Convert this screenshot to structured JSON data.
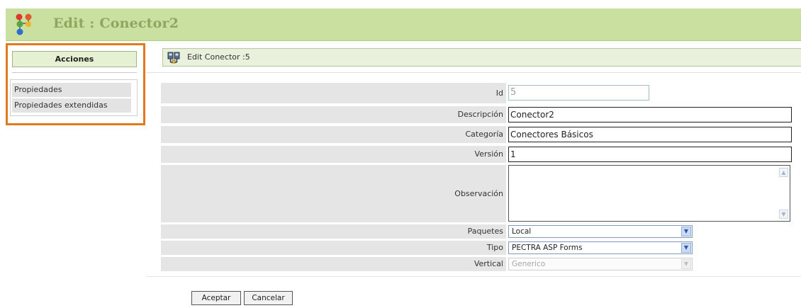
{
  "header": {
    "title": "Edit : Conector2"
  },
  "sidebar": {
    "heading": "Acciones",
    "items": [
      {
        "label": "Propiedades"
      },
      {
        "label": "Propiedades extendidas"
      }
    ]
  },
  "panel": {
    "title": "Edit Conector :5"
  },
  "form": {
    "id": {
      "label": "Id",
      "value": "5"
    },
    "descripcion": {
      "label": "Descripción",
      "value": "Conector2"
    },
    "categoria": {
      "label": "Categoría",
      "value": "Conectores Básicos"
    },
    "version": {
      "label": "Versión",
      "value": "1"
    },
    "observacion": {
      "label": "Observación",
      "value": ""
    },
    "paquetes": {
      "label": "Paquetes",
      "value": "Local"
    },
    "tipo": {
      "label": "Tipo",
      "value": "PECTRA ASP Forms"
    },
    "vertical": {
      "label": "Vertical",
      "value": "Generico"
    }
  },
  "buttons": {
    "accept": "Aceptar",
    "cancel": "Cancelar"
  },
  "colors": {
    "header_bg": "#c9e0a0",
    "title": "#8da660",
    "highlight_border": "#e07a1f",
    "label_bg": "#e5e5e5"
  }
}
